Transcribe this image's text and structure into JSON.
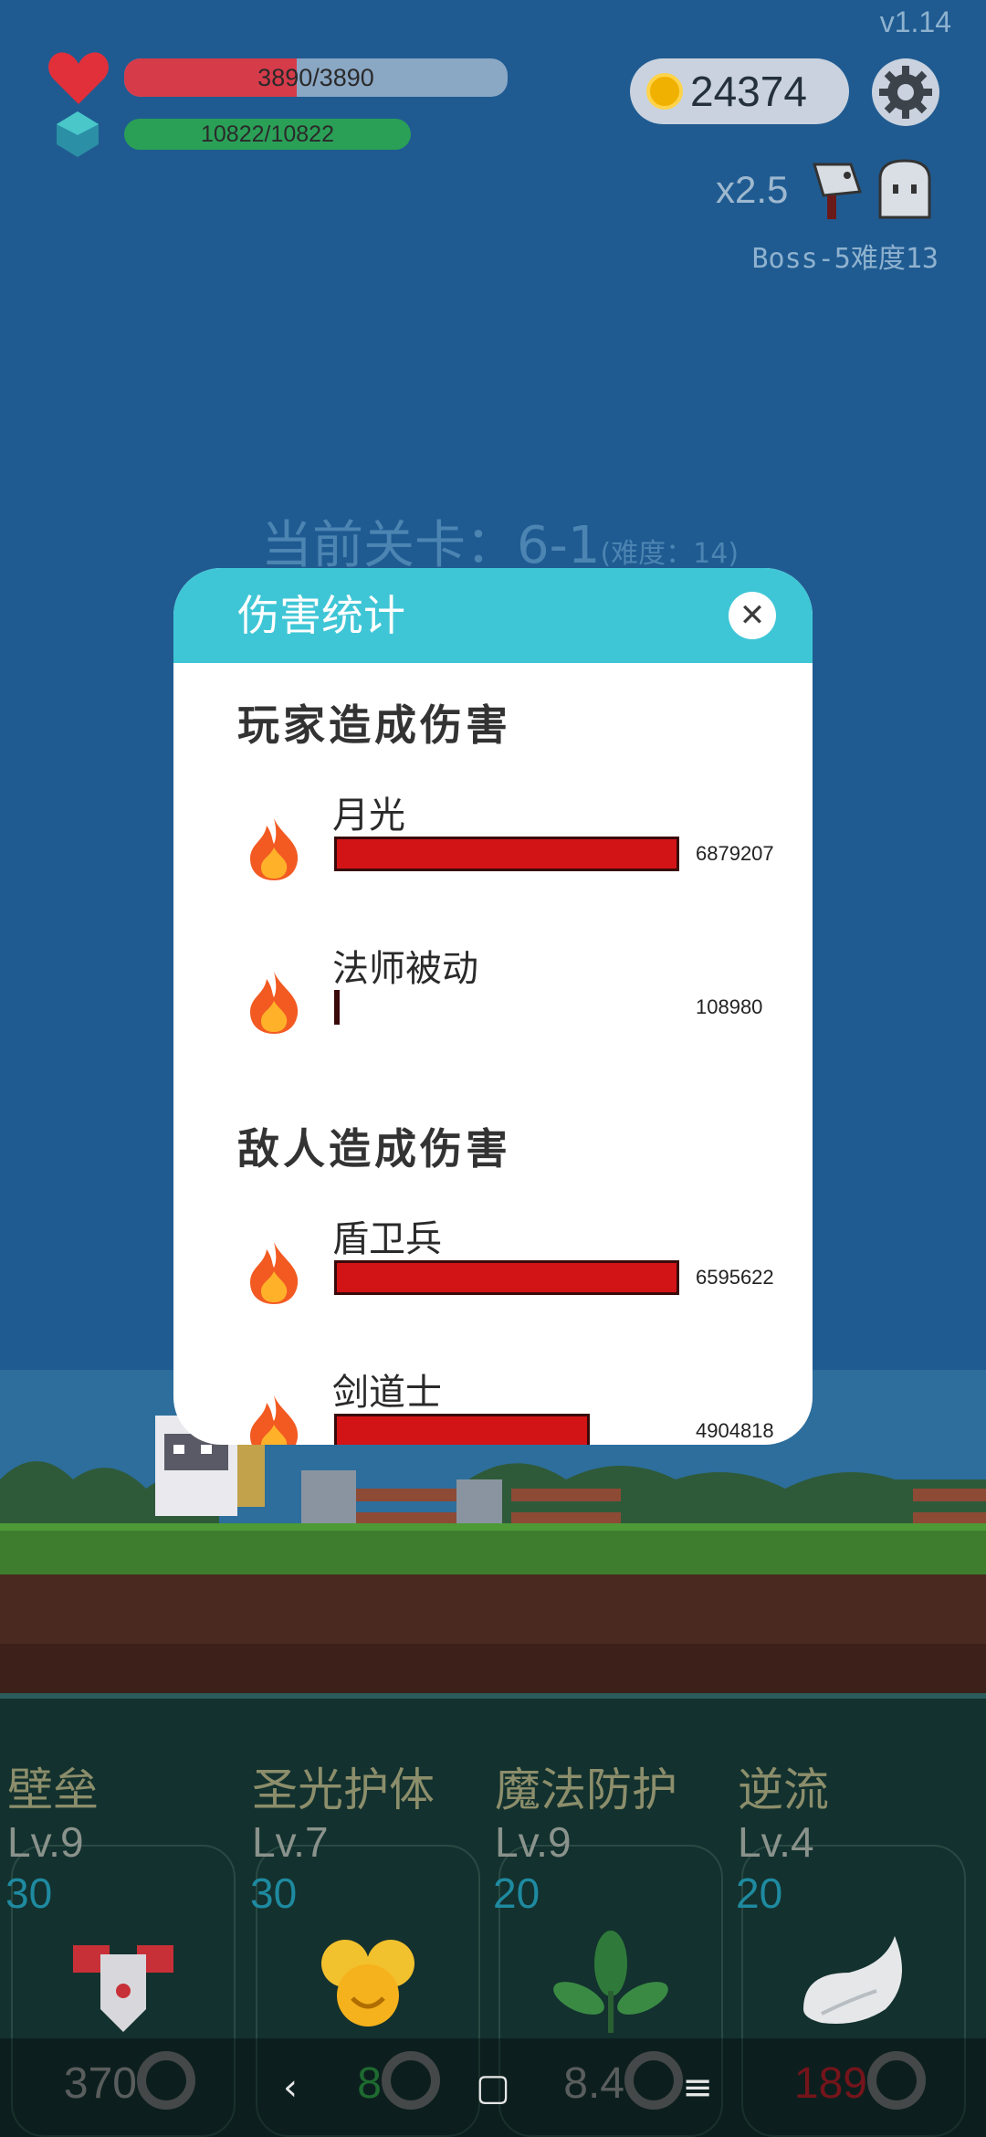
{
  "hud": {
    "version": "v1.14",
    "hp_text": "3890/3890",
    "mp_text": "10822/10822",
    "coins": "24374",
    "speed": "x2.5",
    "boss_label": "Boss-5难度13"
  },
  "stage": {
    "label": "当前关卡：6-1",
    "difficulty": "(难度：14)"
  },
  "modal": {
    "title": "伤害统计",
    "close_symbol": "✕",
    "player_section": "玩家造成伤害",
    "enemy_section": "敌人造成伤害",
    "player_rows": [
      {
        "name": "月光",
        "value": "6879207",
        "fraction": 1.0
      },
      {
        "name": "法师被动",
        "value": "108980",
        "fraction": 0.016
      }
    ],
    "enemy_rows": [
      {
        "name": "盾卫兵",
        "value": "6595622",
        "fraction": 1.0
      },
      {
        "name": "剑道士",
        "value": "4904818",
        "fraction": 0.74
      }
    ]
  },
  "skills": [
    {
      "name": "壁垒",
      "level": "Lv.9",
      "cost": "30",
      "value": "370",
      "value_color": "#8a8f8f"
    },
    {
      "name": "圣光护体",
      "level": "Lv.7",
      "cost": "30",
      "value": "8",
      "value_color": "#2ea34a"
    },
    {
      "name": "魔法防护",
      "level": "Lv.9",
      "cost": "20",
      "value": "8.4",
      "value_color": "#8a8f8f"
    },
    {
      "name": "逆流",
      "level": "Lv.4",
      "cost": "20",
      "value": "189",
      "value_color": "#b21f2a"
    }
  ],
  "nav": {
    "back": "‹",
    "home": "▢",
    "menu": "≡"
  }
}
